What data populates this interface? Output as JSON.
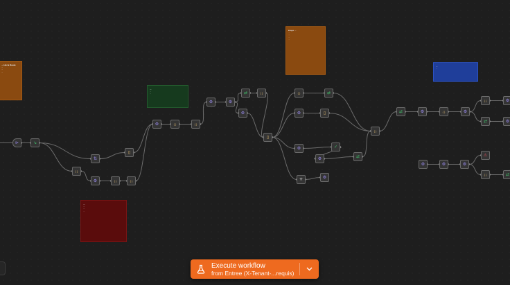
{
  "execute_button": {
    "title": "Execute workflow",
    "subtitle": "from Entree (X-Tenant-...requis)"
  },
  "stickies": [
    {
      "id": "st-left",
      "color": "orange",
      "title": "...t de la Route",
      "lines": [
        "...",
        "...",
        "..."
      ]
    },
    {
      "id": "st-top",
      "color": "orange",
      "title": "Etape ...",
      "lines": [
        "...",
        "...",
        "...",
        "..."
      ]
    },
    {
      "id": "st-mid",
      "color": "green",
      "title": "...",
      "lines": [
        "...",
        "..."
      ]
    },
    {
      "id": "st-bottom",
      "color": "red",
      "title": "...",
      "lines": [
        "...",
        "...",
        "..."
      ]
    },
    {
      "id": "st-right",
      "color": "blue",
      "title": "...",
      "lines": [
        "..."
      ]
    }
  ],
  "nodes": [
    {
      "id": "n1",
      "icon": "⊳",
      "label": "",
      "trigger": true
    },
    {
      "id": "n2",
      "icon": "↘",
      "label": ""
    },
    {
      "id": "n3",
      "icon": "⇅",
      "label": ""
    },
    {
      "id": "n4",
      "icon": "{ }",
      "label": ""
    },
    {
      "id": "n5",
      "icon": "▯",
      "label": ""
    },
    {
      "id": "n6",
      "icon": "⚙",
      "label": ""
    },
    {
      "id": "n7",
      "icon": "{ }",
      "label": ""
    },
    {
      "id": "n8",
      "icon": "{ }",
      "label": ""
    },
    {
      "id": "n9",
      "icon": "⚙",
      "label": ""
    },
    {
      "id": "n10",
      "icon": "{ }",
      "label": ""
    },
    {
      "id": "n11",
      "icon": "{ }",
      "label": ""
    },
    {
      "id": "n12",
      "icon": "⚙",
      "label": ""
    },
    {
      "id": "n13",
      "icon": "⚙",
      "label": ""
    },
    {
      "id": "n14",
      "icon": "⇄",
      "label": ""
    },
    {
      "id": "n15",
      "icon": "{ }",
      "label": ""
    },
    {
      "id": "n16",
      "icon": "⚙",
      "label": ""
    },
    {
      "id": "n17",
      "icon": "▯",
      "label": ""
    },
    {
      "id": "n18",
      "icon": "{ }",
      "label": ""
    },
    {
      "id": "n19",
      "icon": "⇄",
      "label": ""
    },
    {
      "id": "n20",
      "icon": "⚙",
      "label": ""
    },
    {
      "id": "n21",
      "icon": "▯",
      "label": ""
    },
    {
      "id": "n22",
      "icon": "⚙",
      "label": ""
    },
    {
      "id": "n23",
      "icon": "✓",
      "label": ""
    },
    {
      "id": "n24",
      "icon": "⚙",
      "label": ""
    },
    {
      "id": "n25",
      "icon": "⇄",
      "label": ""
    },
    {
      "id": "n26",
      "icon": "✳",
      "label": ""
    },
    {
      "id": "n27",
      "icon": "⚙",
      "label": ""
    },
    {
      "id": "n28",
      "icon": "{ }",
      "label": ""
    },
    {
      "id": "n29",
      "icon": "⇄",
      "label": ""
    },
    {
      "id": "n30",
      "icon": "⚙",
      "label": ""
    },
    {
      "id": "n31",
      "icon": "{ }",
      "label": ""
    },
    {
      "id": "n32",
      "icon": "⚙",
      "label": ""
    },
    {
      "id": "n33",
      "icon": "{ }",
      "label": ""
    },
    {
      "id": "n34",
      "icon": "⚙",
      "label": ""
    },
    {
      "id": "n35",
      "icon": "⇄",
      "label": ""
    },
    {
      "id": "n36",
      "icon": "⚙",
      "label": ""
    },
    {
      "id": "n37",
      "icon": "⚙",
      "label": ""
    },
    {
      "id": "n38",
      "icon": "⚙",
      "label": ""
    },
    {
      "id": "n39",
      "icon": "⚙",
      "label": ""
    },
    {
      "id": "n40",
      "icon": "⚠",
      "label": ""
    },
    {
      "id": "n41",
      "icon": "{ }",
      "label": ""
    },
    {
      "id": "n42",
      "icon": "⇄",
      "label": ""
    },
    {
      "id": "n43",
      "icon": "⚠",
      "label": ""
    },
    {
      "id": "n44",
      "icon": "⚙",
      "label": ""
    },
    {
      "id": "n45",
      "icon": "⚠",
      "label": ""
    }
  ],
  "colors": {
    "canvas": "#1e1e1e",
    "accent": "#ee6a1f",
    "node_icon_purple": "#9b8cf0",
    "node_icon_green": "#3fc26a",
    "node_icon_red": "#e0505a",
    "node_icon_neutral": "#d6b26a"
  }
}
